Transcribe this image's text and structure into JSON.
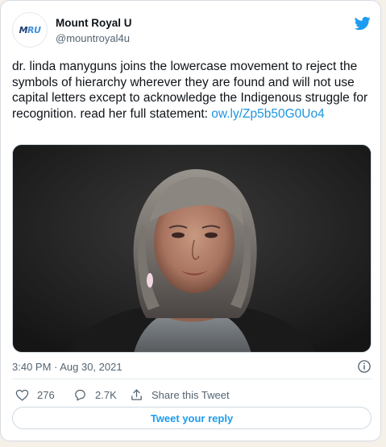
{
  "account": {
    "display_name": "Mount Royal U",
    "handle": "@mountroyal4u",
    "avatar_text_dark": "M",
    "avatar_text_light": "RU",
    "avatar_icon": "mru-logo"
  },
  "tweet": {
    "text": "dr. linda manyguns joins the lowercase movement to reject the symbols of hierarchy wherever they are found and will not use capital letters except to acknowledge the Indigenous struggle for recognition. read her full statement: ",
    "link": "ow.ly/Zp5b50G0Uo4",
    "photo_icon": "portrait-photo"
  },
  "meta": {
    "timestamp": "3:40 PM · Aug 30, 2021"
  },
  "actions": {
    "likes": "276",
    "replies": "2.7K",
    "share_label": "Share this Tweet"
  },
  "reply_button": {
    "label": "Tweet your reply"
  },
  "colors": {
    "twitter_blue": "#1d9bf0",
    "link_blue": "#1b95e0",
    "muted_text": "#536471",
    "page_background": "#f5f0e8"
  }
}
